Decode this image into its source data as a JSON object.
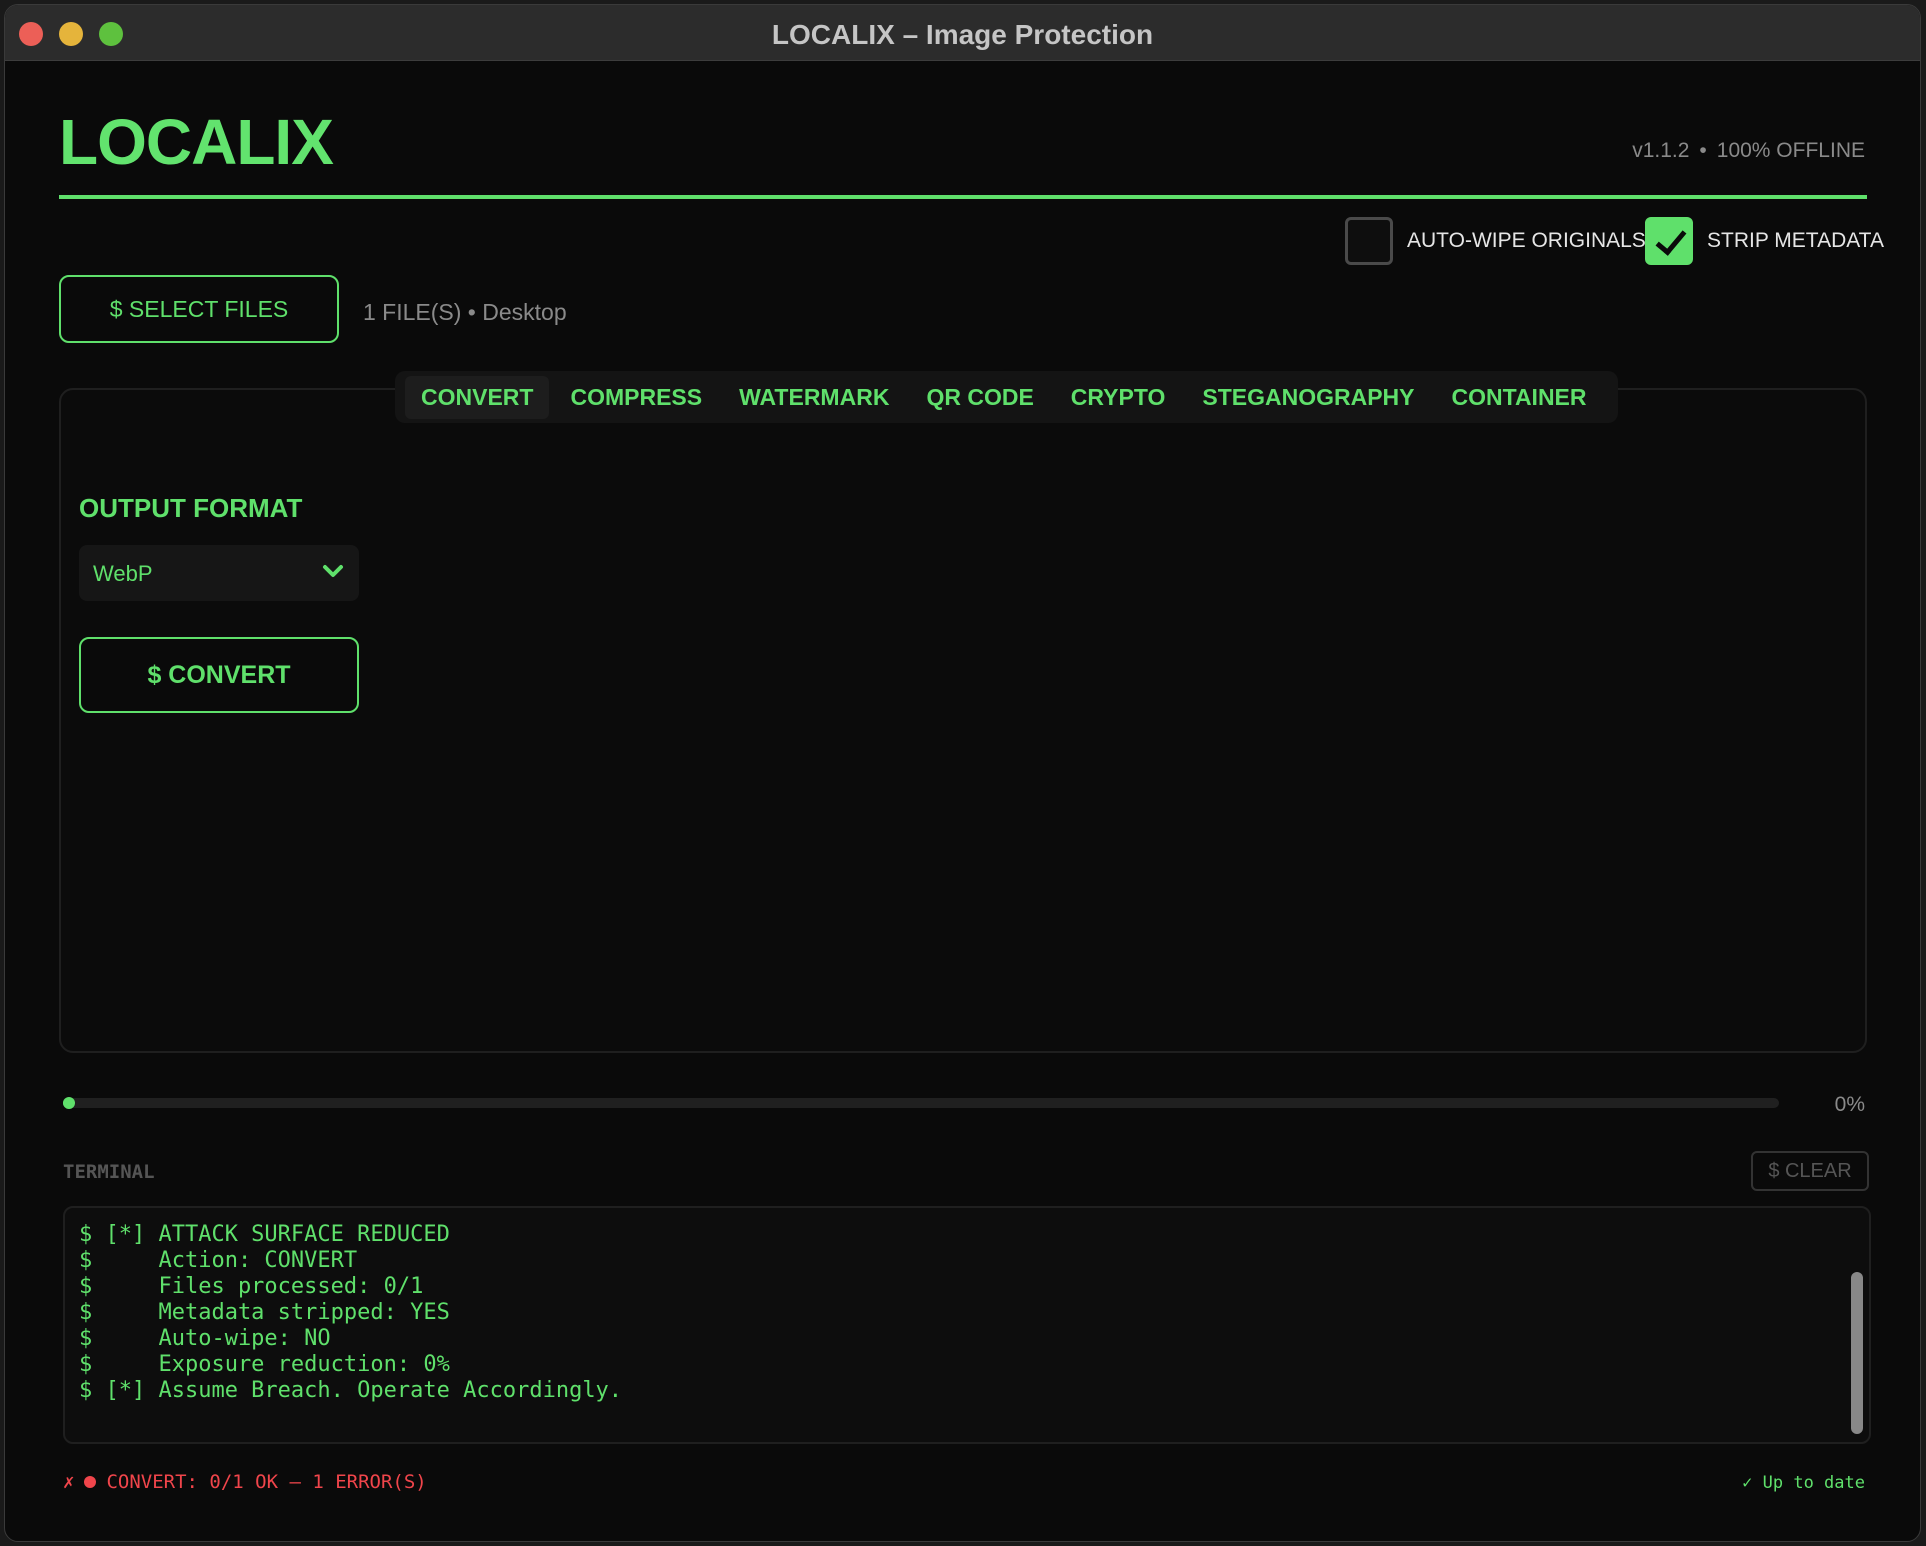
{
  "window": {
    "title": "LOCALIX – Image Protection"
  },
  "header": {
    "logo": "LOCALIX",
    "version": "v1.1.2",
    "separator": "•",
    "mode": "100% OFFLINE"
  },
  "options": {
    "auto_wipe": {
      "label": "AUTO-WIPE ORIGINALS",
      "checked": false
    },
    "strip_metadata": {
      "label": "STRIP METADATA",
      "checked": true
    }
  },
  "files": {
    "select_label": "$ SELECT FILES",
    "info": "1 FILE(S) • Desktop"
  },
  "tabs": [
    {
      "label": "CONVERT",
      "active": true
    },
    {
      "label": "COMPRESS",
      "active": false
    },
    {
      "label": "WATERMARK",
      "active": false
    },
    {
      "label": "QR CODE",
      "active": false
    },
    {
      "label": "CRYPTO",
      "active": false
    },
    {
      "label": "STEGANOGRAPHY",
      "active": false
    },
    {
      "label": "CONTAINER",
      "active": false
    }
  ],
  "convert": {
    "field_label": "OUTPUT FORMAT",
    "format_value": "WebP",
    "button_label": "$ CONVERT"
  },
  "progress": {
    "value": 0,
    "label": "0%"
  },
  "terminal": {
    "label": "TERMINAL",
    "clear_label": "$ CLEAR",
    "lines": [
      "$ [*] ATTACK SURFACE REDUCED",
      "$     Action: CONVERT",
      "$     Files processed: 0/1",
      "$     Metadata stripped: YES",
      "$     Auto-wipe: NO",
      "$     Exposure reduction: 0%",
      "$ [*] Assume Breach. Operate Accordingly."
    ]
  },
  "status": {
    "error_icon": "✗",
    "message": "CONVERT: 0/1 OK — 1 ERROR(S)",
    "update": "✓ Up to date"
  },
  "colors": {
    "accent": "#5fe06b",
    "error": "#f0454b",
    "background": "#0a0a0a"
  },
  "icons": [
    "close-dot-icon",
    "minimize-dot-icon",
    "maximize-dot-icon",
    "checkmark-icon",
    "chevron-down-icon",
    "error-dot-icon"
  ]
}
